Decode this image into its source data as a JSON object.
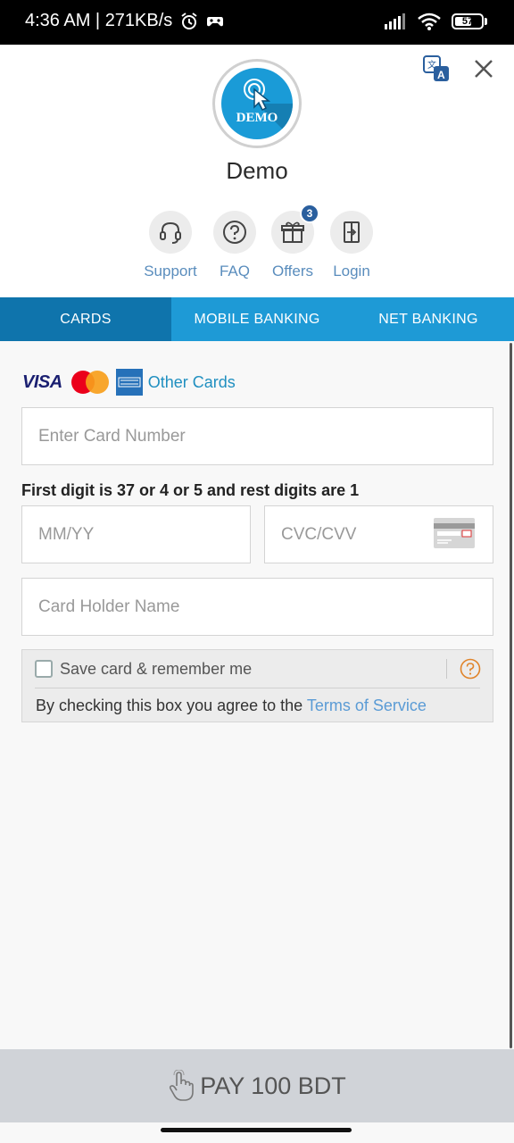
{
  "status_bar": {
    "time_speed": "4:36 AM | 271KB/s",
    "battery": "57"
  },
  "merchant": {
    "logo_text": "DEMO",
    "name": "Demo"
  },
  "quick_actions": [
    {
      "label": "Support",
      "icon": "headset-icon"
    },
    {
      "label": "FAQ",
      "icon": "question-icon"
    },
    {
      "label": "Offers",
      "icon": "gift-icon",
      "badge": "3"
    },
    {
      "label": "Login",
      "icon": "login-icon"
    }
  ],
  "tabs": [
    {
      "label": "CARDS",
      "active": true
    },
    {
      "label": "MOBILE BANKING",
      "active": false
    },
    {
      "label": "NET BANKING",
      "active": false
    }
  ],
  "card_form": {
    "brands": {
      "visa": "VISA",
      "other_cards": "Other Cards"
    },
    "card_number_placeholder": "Enter Card Number",
    "hint": "First digit is 37 or 4 or 5 and rest digits are 1",
    "expiry_placeholder": "MM/YY",
    "cvv_placeholder": "CVC/CVV",
    "holder_placeholder": "Card Holder Name",
    "save_label": "Save card & remember me",
    "agree_prefix": "By checking this box you agree to the ",
    "terms_link": "Terms of Service"
  },
  "pay_button": {
    "label": "PAY 100 BDT"
  },
  "colors": {
    "tab_bar": "#1e9ad6",
    "active_tab": "#0f74ac",
    "link": "#5a9bd5",
    "pay_bar": "#d0d3d8"
  }
}
